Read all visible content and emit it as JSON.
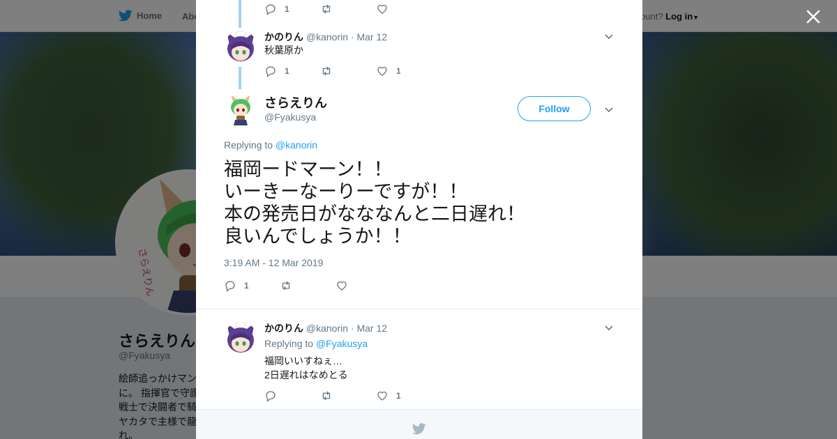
{
  "nav": {
    "home_label": "Home",
    "about_label": "Abo",
    "account_prompt": "ccount?",
    "login_label": "Log in"
  },
  "profile": {
    "name": "さらえりん",
    "handle": "@Fyakusya",
    "bio_lines": [
      "絵師追っかけマン",
      "に。 指揮官で守護",
      "戦士で決闘者で騎",
      "ヤカタで主様で龍",
      "れ。"
    ]
  },
  "tweets": {
    "top_reply": {
      "reply_count": "1"
    },
    "kanorin_1": {
      "name": "かのりん",
      "handle": "@kanorin",
      "sep": "·",
      "date": "Mar 12",
      "text": "秋葉原か",
      "reply_count": "1",
      "like_count": "1"
    },
    "main": {
      "name": "さらえりん",
      "handle": "@Fyakusya",
      "follow_label": "Follow",
      "replying_prefix": "Replying to",
      "replying_to": "@kanorin",
      "text": "福岡ードマーン！！\nいーきーなーりーですが！！\n本の発売日がなななんと二日遅れ！\n良いんでしょうか！！",
      "timestamp": "3:19 AM - 12 Mar 2019",
      "reply_count": "1"
    },
    "kanorin_2": {
      "name": "かのりん",
      "handle": "@kanorin",
      "sep": "·",
      "date": "Mar 12",
      "replying_prefix": "Replying to",
      "replying_to": "@Fyakusya",
      "text": "福岡いいすねぇ…\n2日遅れはなめとる",
      "like_count": "1"
    }
  },
  "colors": {
    "accent": "#1da1f2",
    "thread_line": "#a0d4f6",
    "secondary_text": "#657786"
  }
}
